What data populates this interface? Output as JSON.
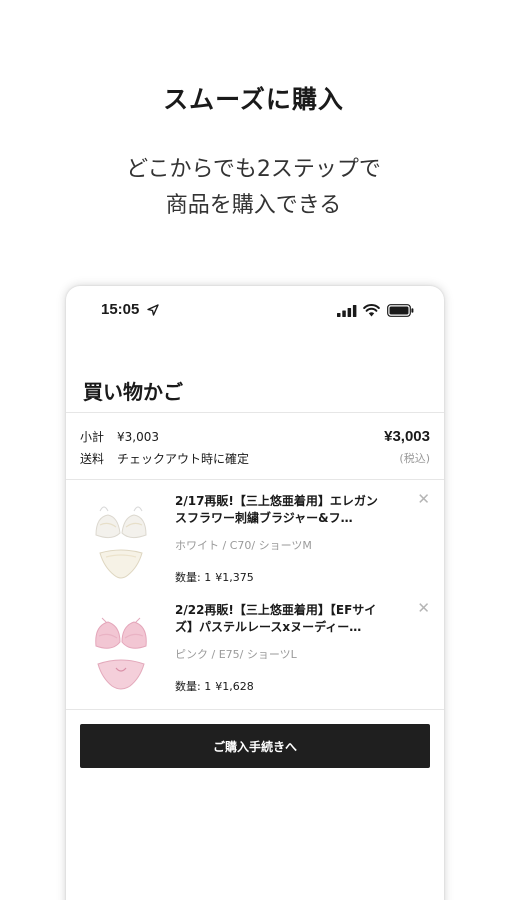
{
  "promo": {
    "headline": "スムーズに購入",
    "subline_1": "どこからでも2ステップで",
    "subline_2": "商品を購入できる"
  },
  "status_bar": {
    "time": "15:05",
    "icons": [
      "location-arrow-icon",
      "cellular-signal-icon",
      "wifi-icon",
      "battery-icon"
    ]
  },
  "cart": {
    "title": "買い物かご",
    "subtotal_label": "小計",
    "subtotal_value": "¥3,003",
    "shipping_label": "送料",
    "shipping_value": "チェックアウト時に確定",
    "total": "¥3,003",
    "tax_note": "(税込)",
    "items": [
      {
        "name_line1": "2/17再販!【三上悠亜着用】エレガン",
        "name_line2": "スフラワー刺繍ブラジャー&フ…",
        "variant": "ホワイト / C70/ ショーツM",
        "qty_label": "数量: 1",
        "price": "¥1,375",
        "image": "white-lingerie-set-thumbnail",
        "remove_icon": "close-icon"
      },
      {
        "name_line1": "2/22再販!【三上悠亜着用】【EFサイ",
        "name_line2": "ズ】パステルレースxヌーディー…",
        "variant": "ピンク / E75/ ショーツL",
        "qty_label": "数量: 1",
        "price": "¥1,628",
        "image": "pink-lingerie-set-thumbnail",
        "remove_icon": "close-icon"
      }
    ],
    "checkout_label": "ご購入手続きへ"
  },
  "colors": {
    "button_bg": "#1f1f1f",
    "muted_text": "#9a9a9a",
    "divider": "#e6e6e6"
  }
}
